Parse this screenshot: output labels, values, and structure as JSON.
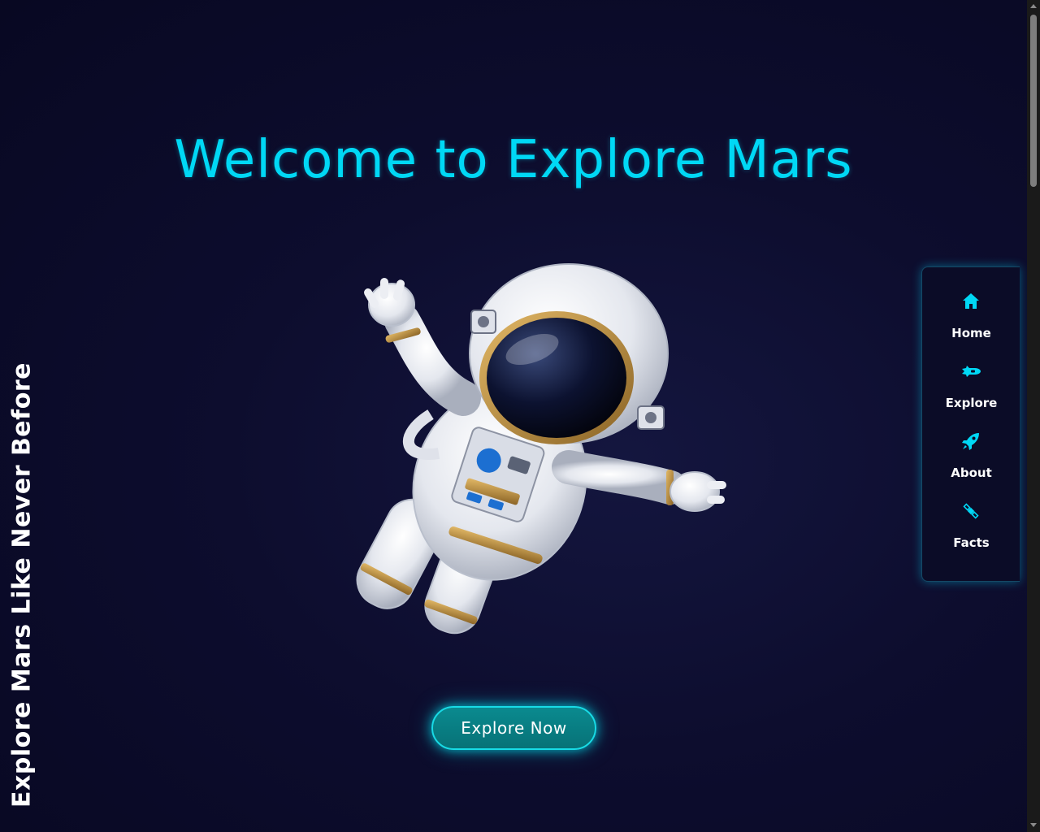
{
  "hero": {
    "title": "Welcome to Explore Mars"
  },
  "side_tagline": "Explore Mars Like Never Before",
  "cta": {
    "label": "Explore Now"
  },
  "nav": {
    "items": [
      {
        "label": "Home",
        "icon": "home-icon"
      },
      {
        "label": "Explore",
        "icon": "spaceship-icon"
      },
      {
        "label": "About",
        "icon": "rocket-icon"
      },
      {
        "label": "Facts",
        "icon": "satellite-icon"
      }
    ]
  },
  "colors": {
    "accent": "#00d8f5",
    "background": "#0d0d2e",
    "button": "#077277"
  },
  "illustration": "astronaut-floating"
}
